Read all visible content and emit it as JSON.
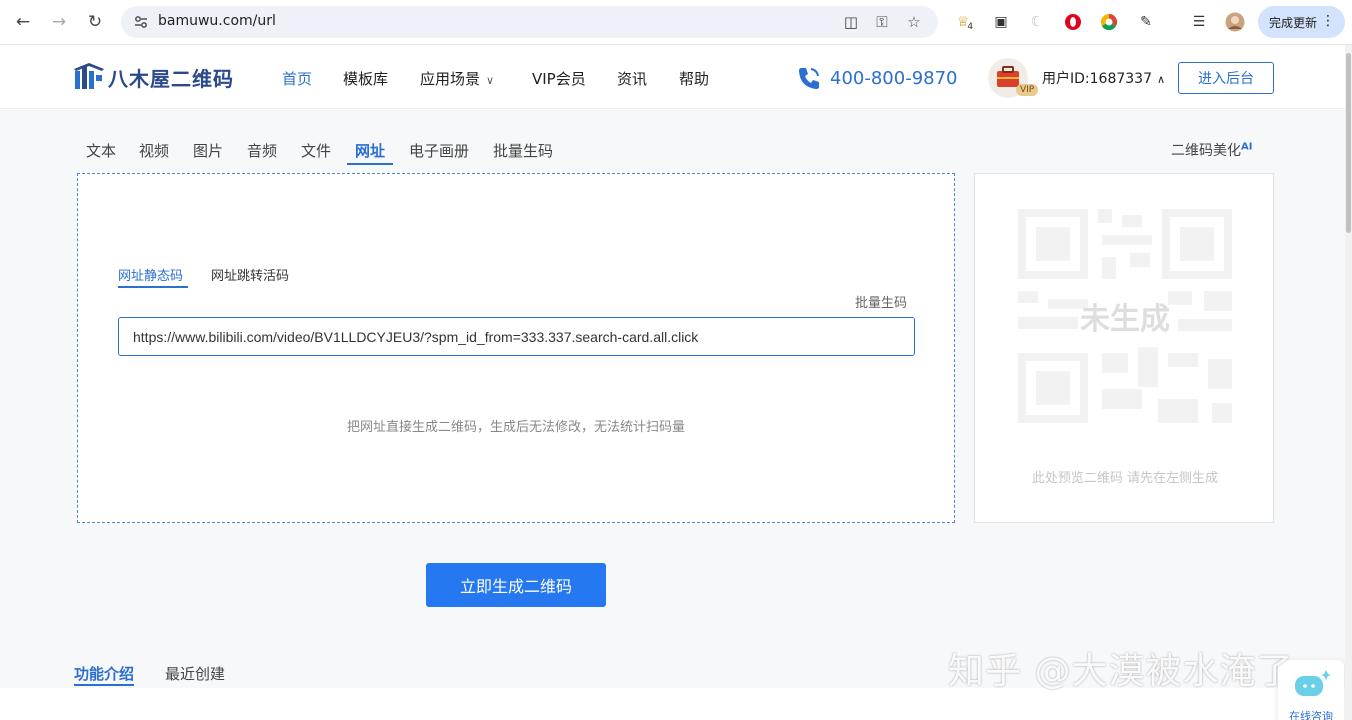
{
  "browser": {
    "url": "bamuwu.com/url",
    "update_label": "完成更新",
    "extension_badge": "4",
    "colors": {
      "omnibox_bg": "#eef1f7",
      "update_bg": "#d3e3fd"
    }
  },
  "header": {
    "logo_text": "八木屋二维码",
    "nav": [
      {
        "label": "首页",
        "active": true
      },
      {
        "label": "模板库"
      },
      {
        "label": "应用场景"
      },
      {
        "label": "VIP会员"
      },
      {
        "label": "资讯"
      },
      {
        "label": "帮助"
      }
    ],
    "phone": "400-800-9870",
    "vip_badge": "VIP",
    "user_id": "用户ID:1687337",
    "backend_button": "进入后台",
    "colors": {
      "accent": "#2b6fd1",
      "logo": "#2b4a8b"
    }
  },
  "main": {
    "type_tabs": [
      {
        "label": "文本"
      },
      {
        "label": "视频"
      },
      {
        "label": "图片"
      },
      {
        "label": "音频"
      },
      {
        "label": "文件"
      },
      {
        "label": "网址",
        "active": true
      },
      {
        "label": "电子画册"
      },
      {
        "label": "批量生码"
      }
    ],
    "beautify_label": "二维码美化",
    "beautify_badge": "AI",
    "editor": {
      "sub_tabs": [
        {
          "label": "网址静态码",
          "active": true
        },
        {
          "label": "网址跳转活码"
        }
      ],
      "batch_link": "批量生码",
      "url_value": "https://www.bilibili.com/video/BV1LLDCYJEU3/?spm_id_from=333.337.search-card.all.click",
      "hint": "把网址直接生成二维码，生成后无法修改，无法统计扫码量"
    },
    "preview": {
      "status": "未生成",
      "hint": "此处预览二维码 请先在左侧生成"
    },
    "generate_button": "立即生成二维码",
    "bottom_tabs": [
      {
        "label": "功能介绍",
        "active": true
      },
      {
        "label": "最近创建"
      }
    ],
    "consult_label": "在线咨询",
    "colors": {
      "primary_button": "#2578f0",
      "editor_border": "#4a8ad6"
    }
  },
  "watermark": "知乎 @大漠被水淹了"
}
